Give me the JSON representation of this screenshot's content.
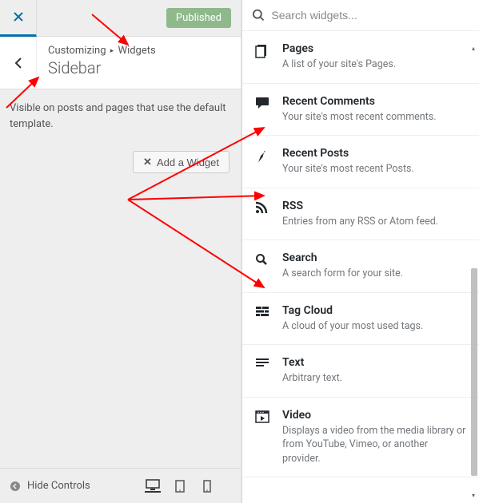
{
  "topbar": {
    "published_label": "Published"
  },
  "header": {
    "breadcrumb_parent": "Customizing",
    "breadcrumb_child": "Widgets",
    "title": "Sidebar"
  },
  "description": "Visible on posts and pages that use the default template.",
  "add_widget_label": "Add a Widget",
  "bottom": {
    "hide_controls_label": "Hide Controls"
  },
  "search": {
    "placeholder": "Search widgets..."
  },
  "widgets": [
    {
      "title": "Pages",
      "desc": "A list of your site's Pages."
    },
    {
      "title": "Recent Comments",
      "desc": "Your site's most recent comments."
    },
    {
      "title": "Recent Posts",
      "desc": "Your site's most recent Posts."
    },
    {
      "title": "RSS",
      "desc": "Entries from any RSS or Atom feed."
    },
    {
      "title": "Search",
      "desc": "A search form for your site."
    },
    {
      "title": "Tag Cloud",
      "desc": "A cloud of your most used tags."
    },
    {
      "title": "Text",
      "desc": "Arbitrary text."
    },
    {
      "title": "Video",
      "desc": "Displays a video from the media library or from YouTube, Vimeo, or another provider."
    }
  ]
}
